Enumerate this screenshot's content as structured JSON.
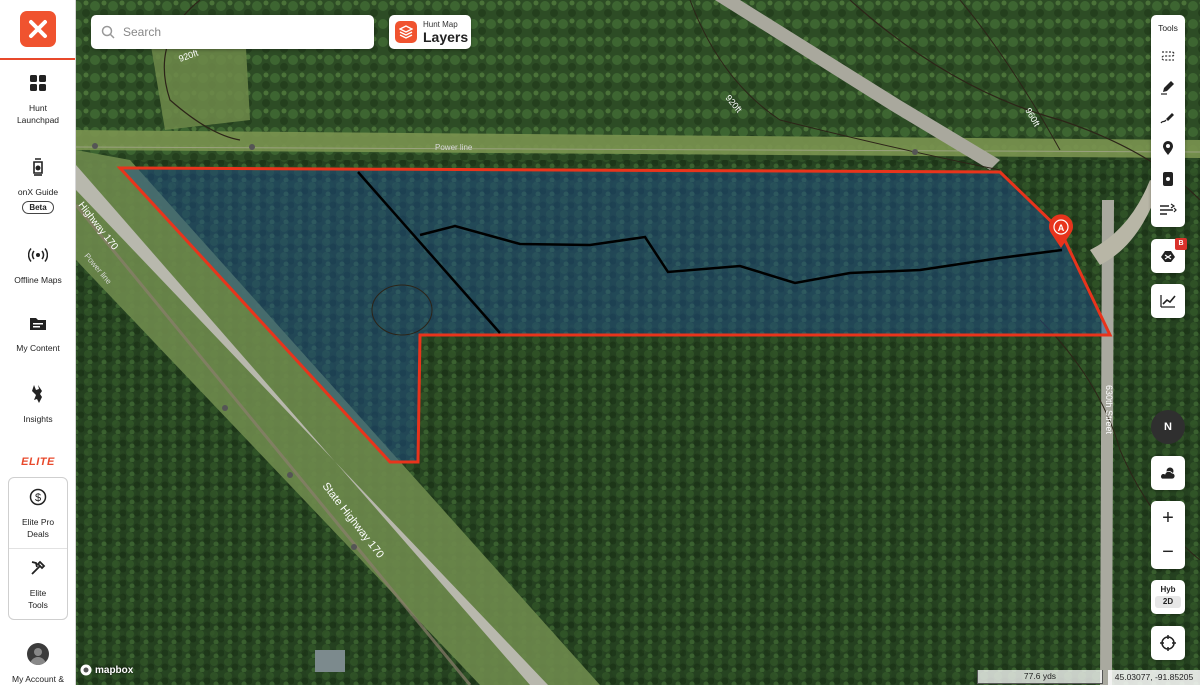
{
  "sidebar": {
    "items": [
      {
        "label": "Hunt\nLaunchpad",
        "icon": "grid-icon"
      },
      {
        "label": "onX Guide",
        "badge": "Beta",
        "icon": "lantern-icon"
      },
      {
        "label": "Offline Maps",
        "icon": "broadcast-icon"
      },
      {
        "label": "My Content",
        "icon": "folder-icon"
      },
      {
        "label": "Insights",
        "icon": "deer-icon"
      }
    ],
    "elite_label": "ELITE",
    "elite_items": [
      {
        "label": "Elite Pro\nDeals",
        "icon": "dollar-icon"
      },
      {
        "label": "Elite\nTools",
        "icon": "tools-icon"
      }
    ],
    "account_label": "My Account &"
  },
  "search": {
    "placeholder": "Search"
  },
  "layers": {
    "sub": "Hunt Map",
    "main": "Layers"
  },
  "tools": {
    "label": "Tools"
  },
  "map": {
    "labels": {
      "power_line_top": "Power line",
      "power_line_bottom": "Power line",
      "highway_top": "Highway 170",
      "highway_main": "State Highway 170",
      "street": "630th Street",
      "contour_920_a": "920ft",
      "contour_920_b": "920ft",
      "contour_960": "960ft"
    },
    "marker": "A",
    "layer_badge": "B",
    "compass": "N",
    "basemap_type": "Hyb",
    "view_mode": "2D",
    "attribution": "mapbox",
    "scale": "77.6 yds",
    "coordinates": "45.03077, -91.85205"
  },
  "colors": {
    "brand": "#f0532f",
    "boundary": "#e8341c",
    "parcel_fill": "#1e4f9a"
  }
}
